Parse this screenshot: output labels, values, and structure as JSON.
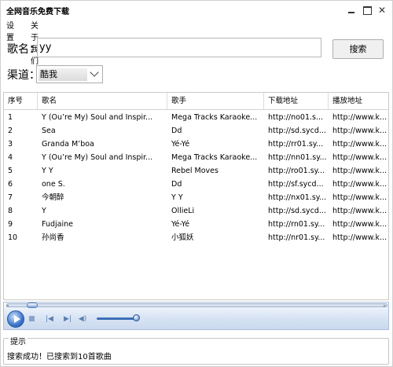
{
  "window": {
    "title": "全网音乐免费下载",
    "close_glyph": "✕"
  },
  "menu": [
    "设置",
    "关于我们"
  ],
  "search": {
    "song_label": "歌名：",
    "song_value": "yy",
    "button_label": "搜索",
    "channel_label": "渠道：",
    "channel_value": "酷我"
  },
  "table": {
    "columns": [
      "序号",
      "歌名",
      "歌手",
      "下载地址",
      "播放地址"
    ],
    "rows": [
      [
        "1",
        "Y (Ou’re My) Soul and Inspir...",
        "Mega Tracks Karaoke...",
        "http://no01.s...",
        "http://www.k..."
      ],
      [
        "2",
        "Sea",
        "Dd",
        "http://sd.sycd...",
        "http://www.k..."
      ],
      [
        "3",
        "Granda M’boa",
        "Yé-Yé",
        "http://rr01.sy...",
        "http://www.k..."
      ],
      [
        "4",
        "Y (Ou’re My) Soul and Inspir...",
        "Mega Tracks Karaoke...",
        "http://nn01.sy...",
        "http://www.k..."
      ],
      [
        "5",
        "Y Y",
        "Rebel Moves",
        "http://ro01.sy...",
        "http://www.k..."
      ],
      [
        "6",
        "one S.",
        "Dd",
        "http://sf.sycd...",
        "http://www.k..."
      ],
      [
        "7",
        "今朝醉",
        "Y Y",
        "http://nx01.sy...",
        "http://www.k..."
      ],
      [
        "8",
        "Y",
        "OllieLi",
        "http://sd.sycd...",
        "http://www.k..."
      ],
      [
        "9",
        "Fudjaine",
        "Yé-Yé",
        "http://rn01.sy...",
        "http://www.k..."
      ],
      [
        "10",
        "孙尚香",
        "小狐妖",
        "http://nr01.sy...",
        "http://www.k..."
      ]
    ]
  },
  "player": {
    "seek_progress": 0.04,
    "volume_level": 0.85,
    "prev_glyph": "|◀",
    "next_glyph": "▶|",
    "volume_glyph": "◀)",
    "seek_start_glyph": "«",
    "seek_end_glyph": "»"
  },
  "status": {
    "title": "提示",
    "message": "搜索成功！已搜索到10首歌曲"
  }
}
